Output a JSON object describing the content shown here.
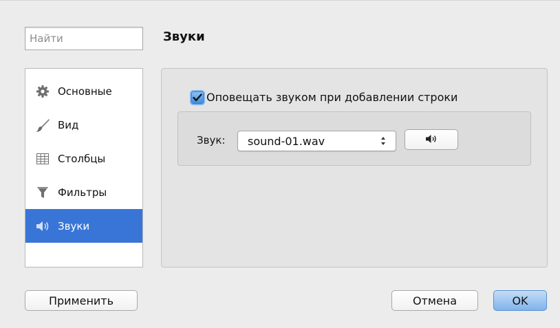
{
  "search": {
    "placeholder": "Найти"
  },
  "page": {
    "title": "Звуки"
  },
  "sidebar": {
    "items": [
      {
        "label": "Основные",
        "icon": "gear-icon"
      },
      {
        "label": "Вид",
        "icon": "brush-icon"
      },
      {
        "label": "Столбцы",
        "icon": "columns-icon"
      },
      {
        "label": "Фильтры",
        "icon": "filter-icon"
      },
      {
        "label": "Звуки",
        "icon": "speaker-icon",
        "selected": true
      }
    ]
  },
  "sounds": {
    "notify_label": "Оповещать звуком при добавлении строки",
    "notify_checked": true,
    "sound_label": "Звук:",
    "sound_value": "sound-01.wav",
    "play_icon": "speaker-icon"
  },
  "buttons": {
    "apply": "Применить",
    "cancel": "Отмена",
    "ok": "OK"
  },
  "colors": {
    "accent": "#3875d7"
  }
}
